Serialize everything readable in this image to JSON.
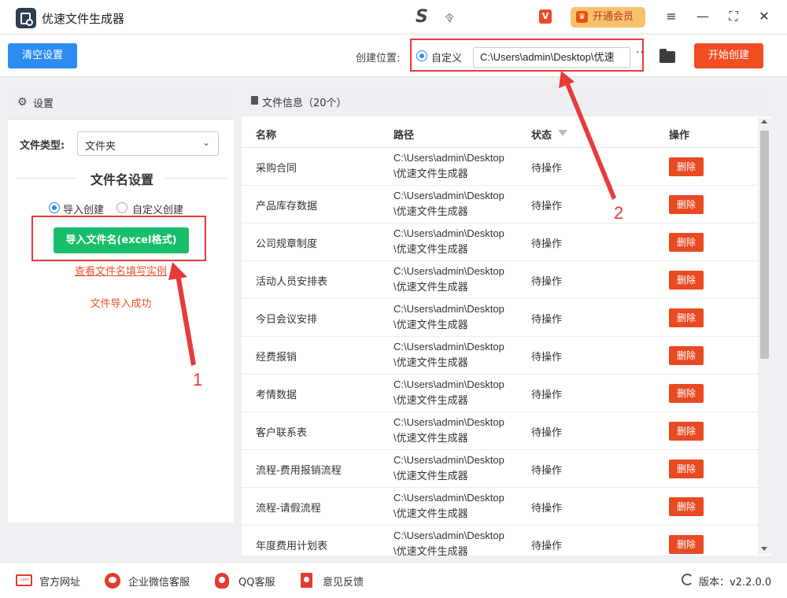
{
  "app": {
    "title": "优速文件生成器",
    "tray_glyph": "S",
    "tray_mark": "令"
  },
  "titlebar": {
    "vip_badge": "V",
    "vip_label": "开通会员",
    "crown": "♛",
    "menu": "≡",
    "minimize": "—",
    "maximize": "⛶",
    "close": "✕"
  },
  "toolbar": {
    "clear_label": "清空设置",
    "location_label": "创建位置:",
    "custom_label": "自定义",
    "path_value": "C:\\Users\\admin\\Desktop\\优速",
    "more": "··",
    "start_label": "开始创建"
  },
  "settings": {
    "header": "设置",
    "gear": "⚙",
    "file_type_label": "文件类型:",
    "file_type_value": "文件夹",
    "chevron": "⌄",
    "section_title": "文件名设置",
    "mode_import": "导入创建",
    "mode_custom": "自定义创建",
    "import_button": "导入文件名(excel格式)",
    "example_link": "查看文件名填写实例",
    "success_text": "文件导入成功"
  },
  "file_info": {
    "header": "文件信息（20个）",
    "columns": {
      "name": "名称",
      "path": "路径",
      "status": "状态",
      "action": "操作"
    },
    "rows": [
      {
        "name": "采购合同",
        "path": "C:\\Users\\admin\\Desktop\\优速文件生成器",
        "status": "待操作",
        "action": "删除"
      },
      {
        "name": "产品库存数据",
        "path": "C:\\Users\\admin\\Desktop\\优速文件生成器",
        "status": "待操作",
        "action": "删除"
      },
      {
        "name": "公司规章制度",
        "path": "C:\\Users\\admin\\Desktop\\优速文件生成器",
        "status": "待操作",
        "action": "删除"
      },
      {
        "name": "活动人员安排表",
        "path": "C:\\Users\\admin\\Desktop\\优速文件生成器",
        "status": "待操作",
        "action": "删除"
      },
      {
        "name": "今日会议安排",
        "path": "C:\\Users\\admin\\Desktop\\优速文件生成器",
        "status": "待操作",
        "action": "删除"
      },
      {
        "name": "经费报销",
        "path": "C:\\Users\\admin\\Desktop\\优速文件生成器",
        "status": "待操作",
        "action": "删除"
      },
      {
        "name": "考情数据",
        "path": "C:\\Users\\admin\\Desktop\\优速文件生成器",
        "status": "待操作",
        "action": "删除"
      },
      {
        "name": "客户联系表",
        "path": "C:\\Users\\admin\\Desktop\\优速文件生成器",
        "status": "待操作",
        "action": "删除"
      },
      {
        "name": "流程-费用报销流程",
        "path": "C:\\Users\\admin\\Desktop\\优速文件生成器",
        "status": "待操作",
        "action": "删除"
      },
      {
        "name": "流程-请假流程",
        "path": "C:\\Users\\admin\\Desktop\\优速文件生成器",
        "status": "待操作",
        "action": "删除"
      },
      {
        "name": "年度费用计划表",
        "path": "C:\\Users\\admin\\Desktop\\优速文件生成器",
        "status": "待操作",
        "action": "删除"
      }
    ]
  },
  "footer": {
    "website": "官方网址",
    "website_glyph": ".com",
    "wechat": "企业微信客服",
    "qq": "QQ客服",
    "feedback": "意见反馈",
    "version": "版本：v2.2.0.0"
  },
  "annotations": {
    "marker_1": "1",
    "marker_2": "2"
  },
  "colors": {
    "primary_blue": "#2d8cf0",
    "start_red": "#f04e23",
    "import_green": "#19be6b",
    "delete_red": "#e84a23",
    "annotation_red": "#e83a3a",
    "link_orange": "#e8532c"
  }
}
